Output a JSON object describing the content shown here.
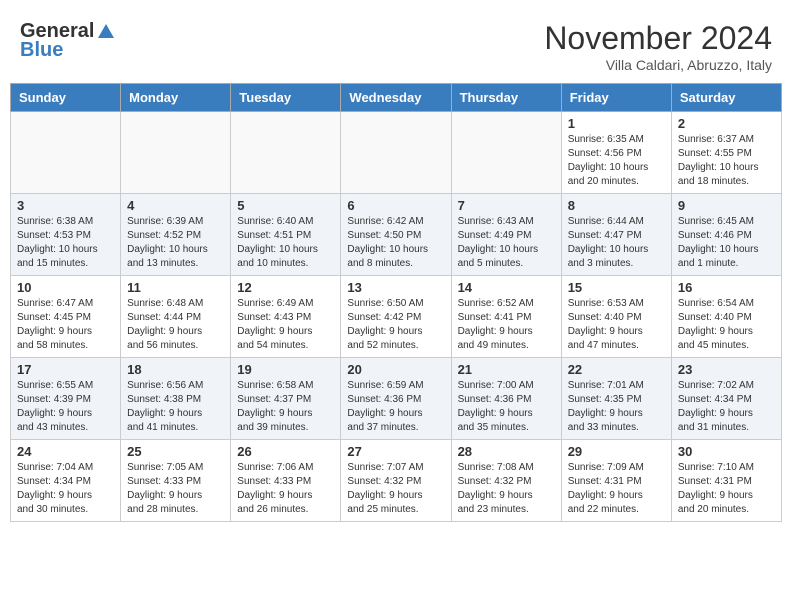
{
  "logo": {
    "general": "General",
    "blue": "Blue"
  },
  "header": {
    "month": "November 2024",
    "location": "Villa Caldari, Abruzzo, Italy"
  },
  "weekdays": [
    "Sunday",
    "Monday",
    "Tuesday",
    "Wednesday",
    "Thursday",
    "Friday",
    "Saturday"
  ],
  "weeks": [
    [
      {
        "day": "",
        "info": ""
      },
      {
        "day": "",
        "info": ""
      },
      {
        "day": "",
        "info": ""
      },
      {
        "day": "",
        "info": ""
      },
      {
        "day": "",
        "info": ""
      },
      {
        "day": "1",
        "info": "Sunrise: 6:35 AM\nSunset: 4:56 PM\nDaylight: 10 hours\nand 20 minutes."
      },
      {
        "day": "2",
        "info": "Sunrise: 6:37 AM\nSunset: 4:55 PM\nDaylight: 10 hours\nand 18 minutes."
      }
    ],
    [
      {
        "day": "3",
        "info": "Sunrise: 6:38 AM\nSunset: 4:53 PM\nDaylight: 10 hours\nand 15 minutes."
      },
      {
        "day": "4",
        "info": "Sunrise: 6:39 AM\nSunset: 4:52 PM\nDaylight: 10 hours\nand 13 minutes."
      },
      {
        "day": "5",
        "info": "Sunrise: 6:40 AM\nSunset: 4:51 PM\nDaylight: 10 hours\nand 10 minutes."
      },
      {
        "day": "6",
        "info": "Sunrise: 6:42 AM\nSunset: 4:50 PM\nDaylight: 10 hours\nand 8 minutes."
      },
      {
        "day": "7",
        "info": "Sunrise: 6:43 AM\nSunset: 4:49 PM\nDaylight: 10 hours\nand 5 minutes."
      },
      {
        "day": "8",
        "info": "Sunrise: 6:44 AM\nSunset: 4:47 PM\nDaylight: 10 hours\nand 3 minutes."
      },
      {
        "day": "9",
        "info": "Sunrise: 6:45 AM\nSunset: 4:46 PM\nDaylight: 10 hours\nand 1 minute."
      }
    ],
    [
      {
        "day": "10",
        "info": "Sunrise: 6:47 AM\nSunset: 4:45 PM\nDaylight: 9 hours\nand 58 minutes."
      },
      {
        "day": "11",
        "info": "Sunrise: 6:48 AM\nSunset: 4:44 PM\nDaylight: 9 hours\nand 56 minutes."
      },
      {
        "day": "12",
        "info": "Sunrise: 6:49 AM\nSunset: 4:43 PM\nDaylight: 9 hours\nand 54 minutes."
      },
      {
        "day": "13",
        "info": "Sunrise: 6:50 AM\nSunset: 4:42 PM\nDaylight: 9 hours\nand 52 minutes."
      },
      {
        "day": "14",
        "info": "Sunrise: 6:52 AM\nSunset: 4:41 PM\nDaylight: 9 hours\nand 49 minutes."
      },
      {
        "day": "15",
        "info": "Sunrise: 6:53 AM\nSunset: 4:40 PM\nDaylight: 9 hours\nand 47 minutes."
      },
      {
        "day": "16",
        "info": "Sunrise: 6:54 AM\nSunset: 4:40 PM\nDaylight: 9 hours\nand 45 minutes."
      }
    ],
    [
      {
        "day": "17",
        "info": "Sunrise: 6:55 AM\nSunset: 4:39 PM\nDaylight: 9 hours\nand 43 minutes."
      },
      {
        "day": "18",
        "info": "Sunrise: 6:56 AM\nSunset: 4:38 PM\nDaylight: 9 hours\nand 41 minutes."
      },
      {
        "day": "19",
        "info": "Sunrise: 6:58 AM\nSunset: 4:37 PM\nDaylight: 9 hours\nand 39 minutes."
      },
      {
        "day": "20",
        "info": "Sunrise: 6:59 AM\nSunset: 4:36 PM\nDaylight: 9 hours\nand 37 minutes."
      },
      {
        "day": "21",
        "info": "Sunrise: 7:00 AM\nSunset: 4:36 PM\nDaylight: 9 hours\nand 35 minutes."
      },
      {
        "day": "22",
        "info": "Sunrise: 7:01 AM\nSunset: 4:35 PM\nDaylight: 9 hours\nand 33 minutes."
      },
      {
        "day": "23",
        "info": "Sunrise: 7:02 AM\nSunset: 4:34 PM\nDaylight: 9 hours\nand 31 minutes."
      }
    ],
    [
      {
        "day": "24",
        "info": "Sunrise: 7:04 AM\nSunset: 4:34 PM\nDaylight: 9 hours\nand 30 minutes."
      },
      {
        "day": "25",
        "info": "Sunrise: 7:05 AM\nSunset: 4:33 PM\nDaylight: 9 hours\nand 28 minutes."
      },
      {
        "day": "26",
        "info": "Sunrise: 7:06 AM\nSunset: 4:33 PM\nDaylight: 9 hours\nand 26 minutes."
      },
      {
        "day": "27",
        "info": "Sunrise: 7:07 AM\nSunset: 4:32 PM\nDaylight: 9 hours\nand 25 minutes."
      },
      {
        "day": "28",
        "info": "Sunrise: 7:08 AM\nSunset: 4:32 PM\nDaylight: 9 hours\nand 23 minutes."
      },
      {
        "day": "29",
        "info": "Sunrise: 7:09 AM\nSunset: 4:31 PM\nDaylight: 9 hours\nand 22 minutes."
      },
      {
        "day": "30",
        "info": "Sunrise: 7:10 AM\nSunset: 4:31 PM\nDaylight: 9 hours\nand 20 minutes."
      }
    ]
  ]
}
